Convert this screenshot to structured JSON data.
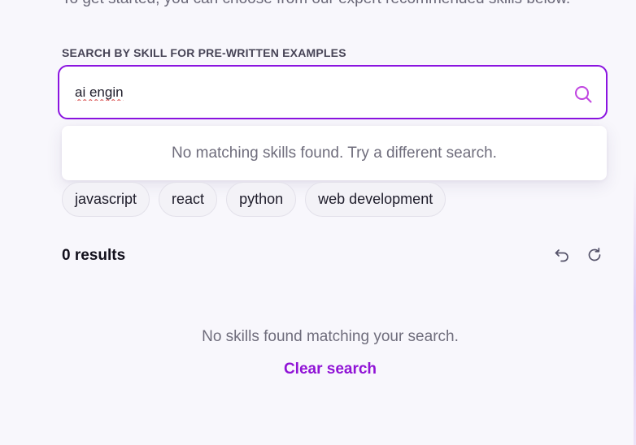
{
  "intro": {
    "text": "To get started, you can choose from our expert recommended skills below."
  },
  "search": {
    "section_label": "SEARCH BY SKILL FOR PRE-WRITTEN EXAMPLES",
    "value": "ai engin",
    "icon": "search-icon",
    "border_color": "#8b14e0"
  },
  "dropdown": {
    "message": "No matching skills found. Try a different search."
  },
  "chips": [
    {
      "label": "javascript"
    },
    {
      "label": "react"
    },
    {
      "label": "python"
    },
    {
      "label": "web development"
    }
  ],
  "results": {
    "count_label": "0 results",
    "undo_icon": "undo-icon",
    "refresh_icon": "refresh-icon"
  },
  "empty_state": {
    "message": "No skills found matching your search.",
    "clear_label": "Clear search",
    "link_color": "#9013d6"
  }
}
